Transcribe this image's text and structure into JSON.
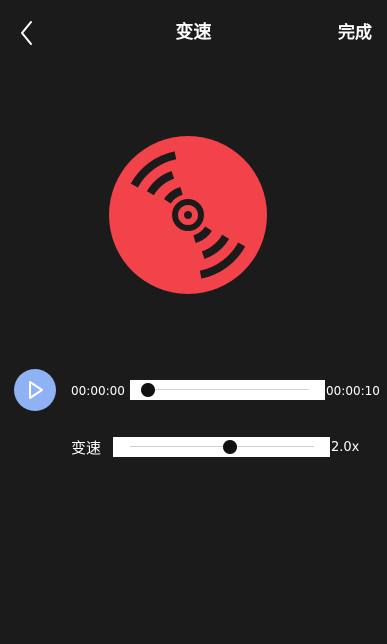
{
  "header": {
    "title": "变速",
    "done_label": "完成"
  },
  "player": {
    "current_time": "00:00:00",
    "total_time": "00:00:10",
    "progress_fraction": 0.0
  },
  "speed": {
    "label": "变速",
    "value_text": "2.0x",
    "fraction": 0.55
  },
  "colors": {
    "background": "#1b1b1b",
    "disc": "#f2424a",
    "play_button": "#8fb2f4"
  },
  "icons": {
    "back": "chevron-left-icon",
    "disc": "vinyl-record-icon",
    "play": "play-icon"
  }
}
